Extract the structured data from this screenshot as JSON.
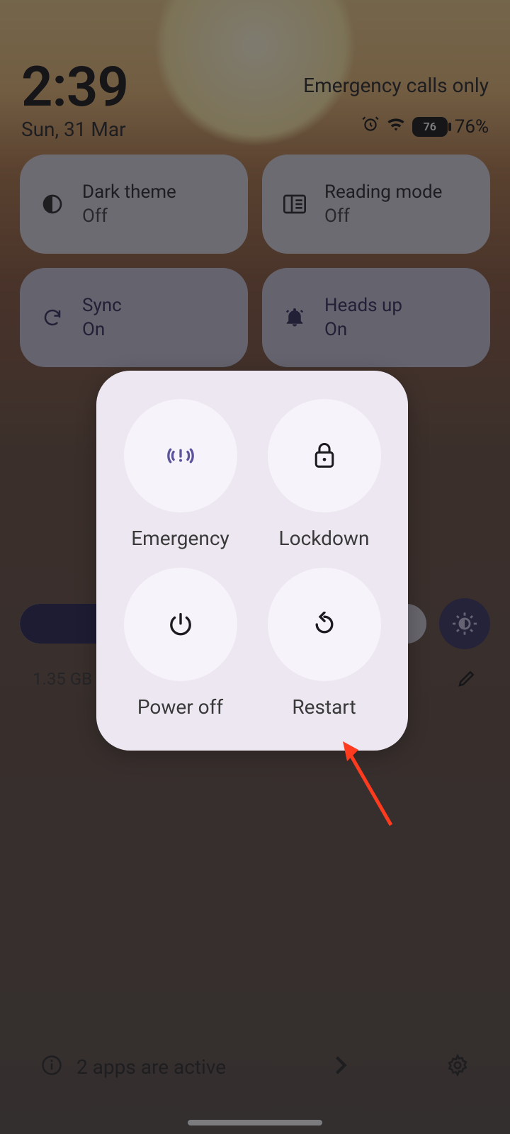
{
  "status": {
    "time": "2:39",
    "emergency_label": "Emergency calls only",
    "date": "Sun, 31 Mar",
    "battery_text": "76",
    "battery_percent": "76%"
  },
  "tiles": [
    {
      "title": "Dark theme",
      "state": "Off"
    },
    {
      "title": "Reading mode",
      "state": "Off"
    },
    {
      "title": "Sync",
      "state": "On"
    },
    {
      "title": "Heads up",
      "state": "On"
    }
  ],
  "memory": {
    "text": "1.35 GB used"
  },
  "bottom": {
    "apps_active": "2 apps are active"
  },
  "power_menu": {
    "items": [
      {
        "label": "Emergency"
      },
      {
        "label": "Lockdown"
      },
      {
        "label": "Power off"
      },
      {
        "label": "Restart"
      }
    ]
  }
}
